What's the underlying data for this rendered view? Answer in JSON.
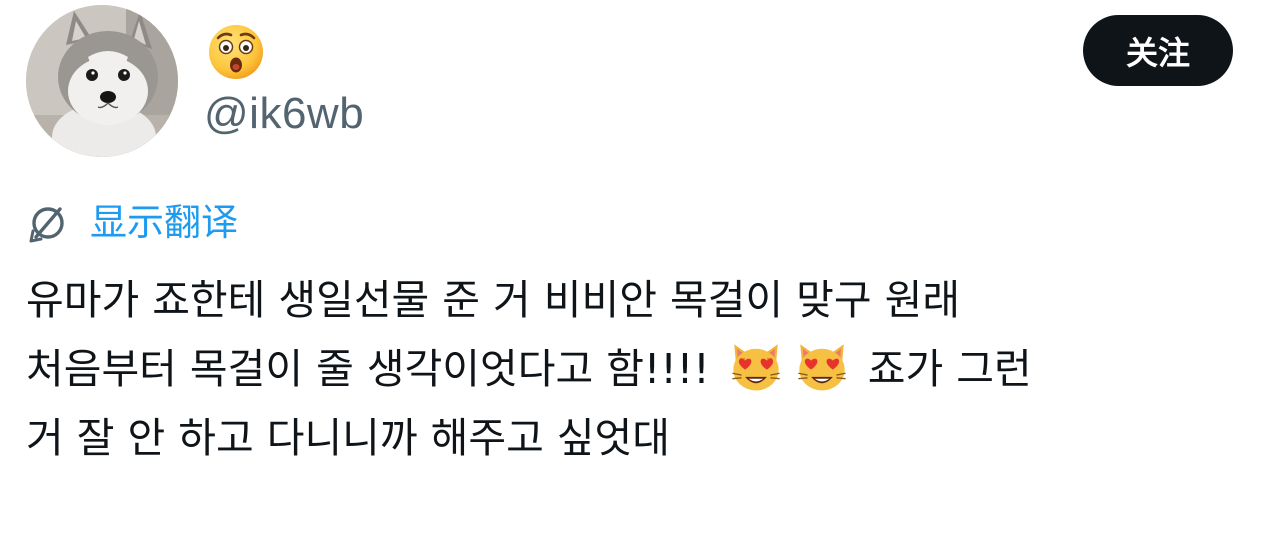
{
  "tweet": {
    "author": {
      "avatar_icon": "puppy-avatar",
      "display_name_icon": "astonished-face-emoji",
      "handle": "@ik6wb"
    },
    "follow_button_label": "关注",
    "translate": {
      "icon": "translate-globe-icon",
      "label": "显示翻译"
    },
    "text": {
      "line1": "유마가 죠한테 생일선물 준 거 비비안 목걸이 맞구 원래",
      "line2_before": "처음부터 목걸이 줄 생각이엇다고 함!!!! ",
      "line2_emoji_1": "smiling-cat-heart-eyes-emoji",
      "line2_emoji_2": "smiling-cat-heart-eyes-emoji",
      "line2_after": " 죠가 그런",
      "line3": "거 잘 안 하고 다니니까 해주고 싶엇대"
    }
  },
  "colors": {
    "text": "#0f1419",
    "secondary": "#536471",
    "link": "#1d9bf0",
    "button_bg": "#0f1419",
    "button_text": "#ffffff"
  }
}
